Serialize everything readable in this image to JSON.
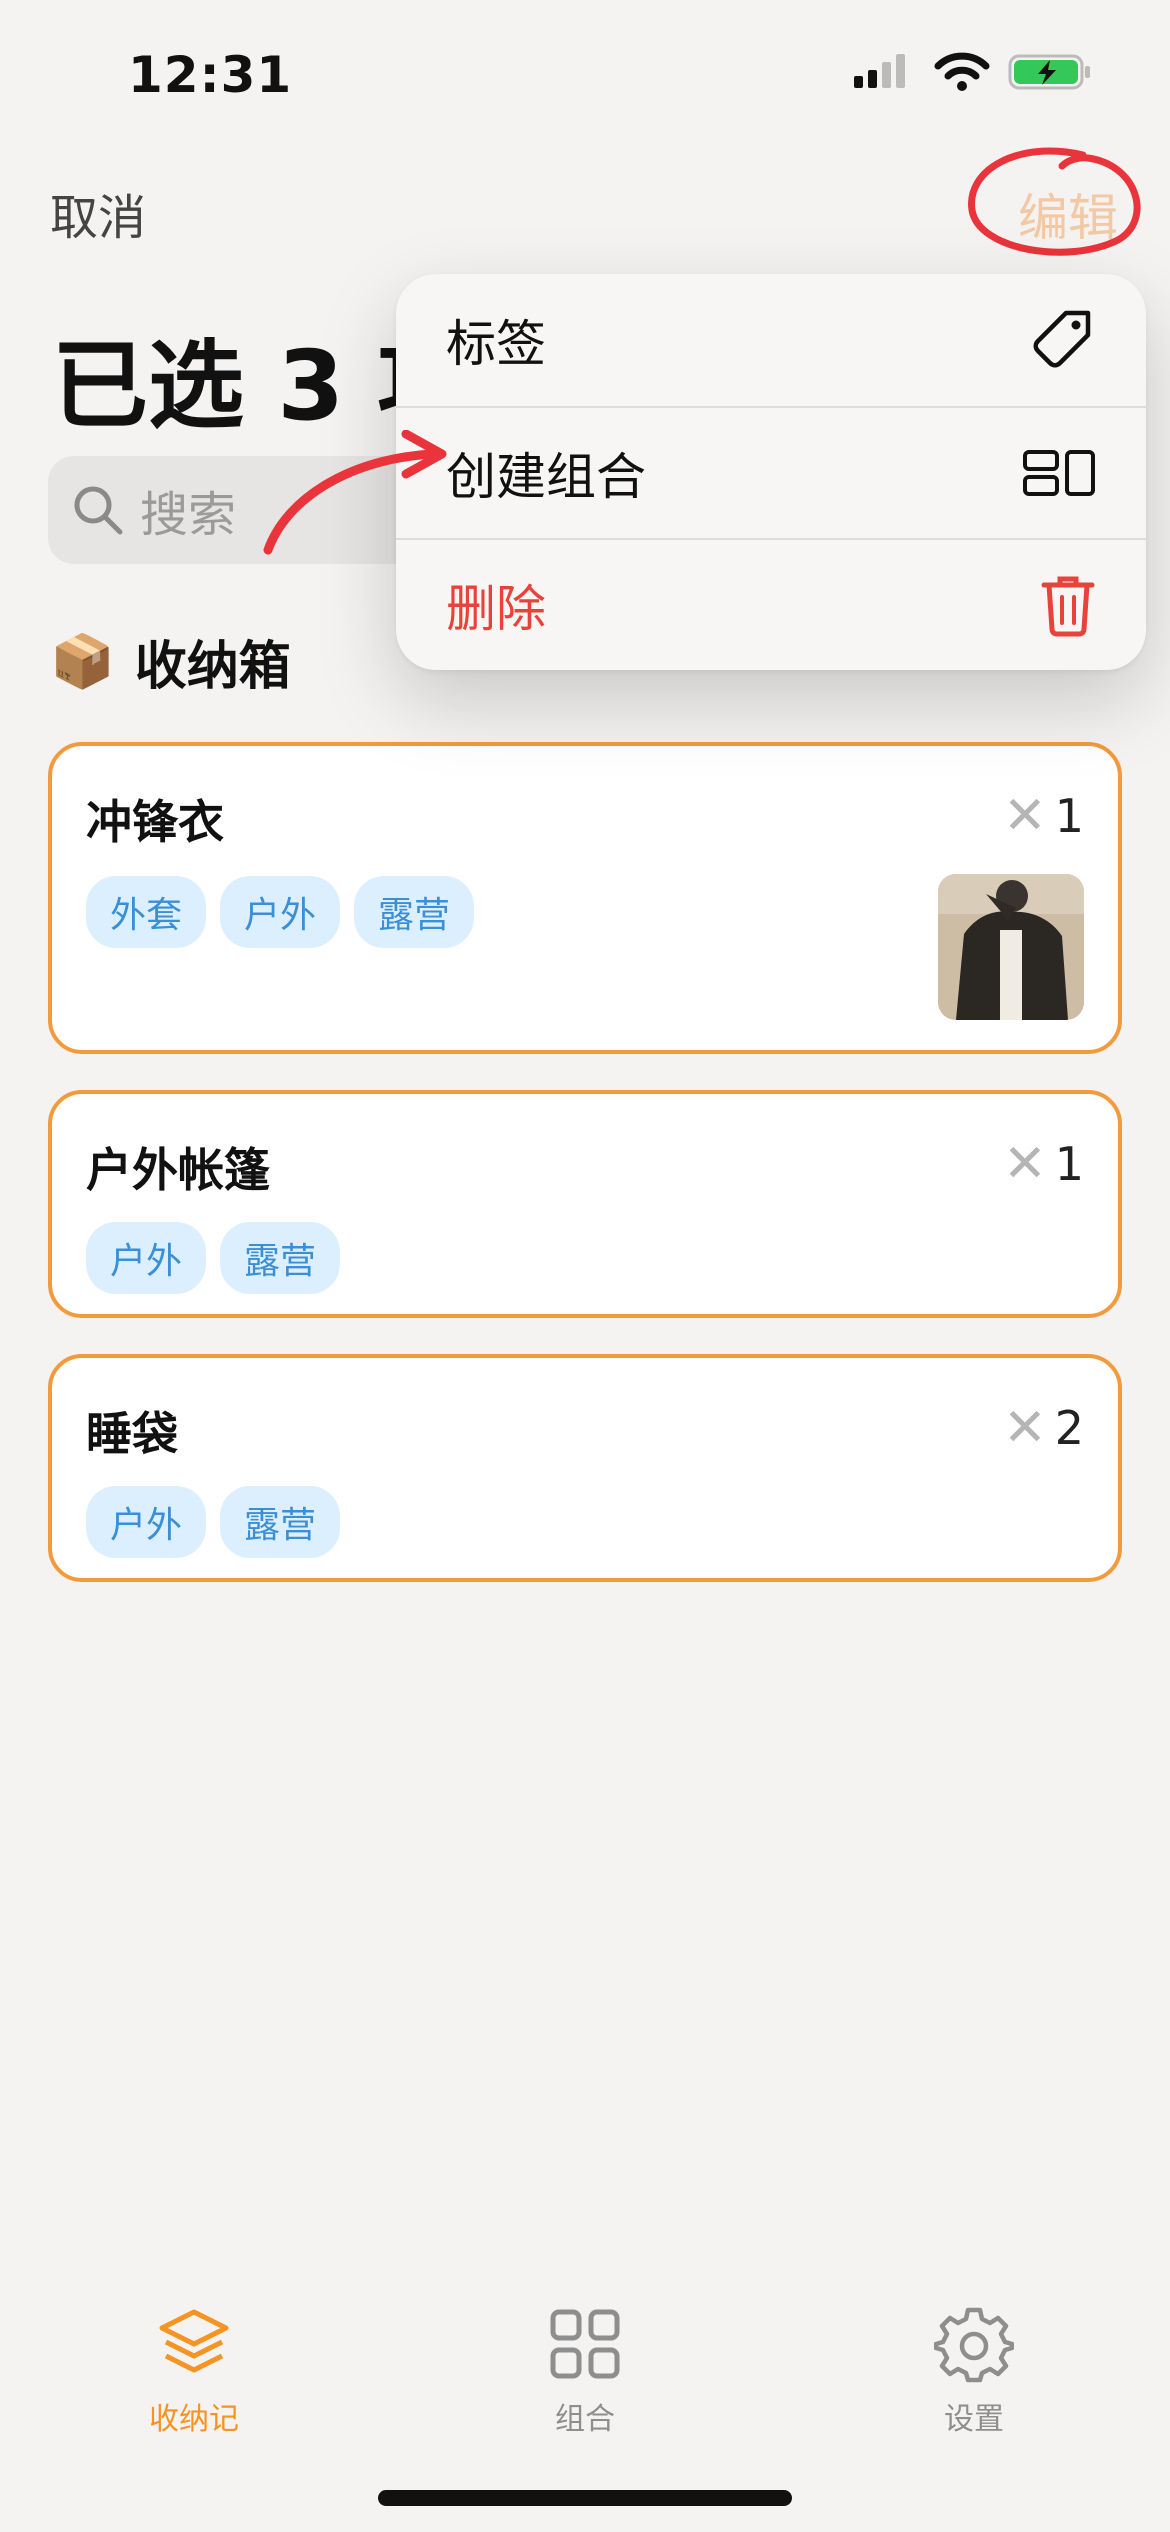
{
  "status": {
    "time": "12:31"
  },
  "nav": {
    "cancel_label": "取消",
    "edit_label": "编辑"
  },
  "header": {
    "title": "已选 3 项"
  },
  "search": {
    "placeholder": "搜索"
  },
  "section": {
    "emoji": "📦",
    "label": "收纳箱"
  },
  "items": [
    {
      "name": "冲锋衣",
      "qty": "1",
      "tags": [
        "外套",
        "户外",
        "露营"
      ],
      "has_photo": true
    },
    {
      "name": "户外帐篷",
      "qty": "1",
      "tags": [
        "户外",
        "露营"
      ]
    },
    {
      "name": "睡袋",
      "qty": "2",
      "tags": [
        "户外",
        "露营"
      ]
    }
  ],
  "menu": {
    "items": [
      {
        "label": "标签",
        "icon": "tag-icon"
      },
      {
        "label": "创建组合",
        "icon": "group-icon"
      },
      {
        "label": "删除",
        "icon": "trash-icon",
        "destructive": true
      }
    ]
  },
  "tabbar": {
    "tabs": [
      {
        "label": "收纳记",
        "icon": "layers-icon",
        "active": true
      },
      {
        "label": "组合",
        "icon": "grid-icon"
      },
      {
        "label": "设置",
        "icon": "gear-icon"
      }
    ]
  },
  "colors": {
    "accent": "#f59323",
    "card_border": "#f39a3c",
    "tag_bg": "#dcefff",
    "tag_text": "#3a8fd6",
    "destructive": "#e8433b",
    "annotation": "#e8343a"
  }
}
